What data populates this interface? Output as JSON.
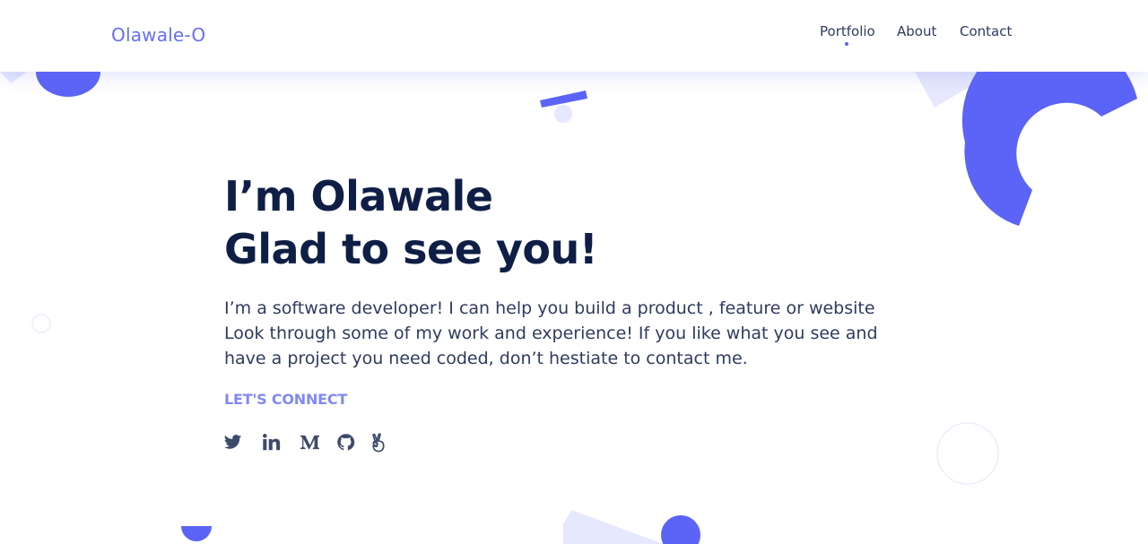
{
  "colors": {
    "accent": "#5b64f6",
    "accent_light": "#e6e8fd",
    "heading": "#0e1e45",
    "body_text": "#2e3b5e",
    "connect_label": "#8189f4"
  },
  "header": {
    "logo": "Olawale-O",
    "nav": [
      {
        "label": "Portfolio",
        "active": true
      },
      {
        "label": "About",
        "active": false
      },
      {
        "label": "Contact",
        "active": false
      }
    ]
  },
  "hero": {
    "headline_line1": "I’m Olawale",
    "headline_line2": "Glad to see you!",
    "bio": "I’m a software developer! I can help you build a product , feature or website Look through some of my work and experience! If you like what you see and have a project you need coded, don’t hestiate to contact me.",
    "connect_label": "LET'S CONNECT"
  },
  "social_links": [
    {
      "icon": "twitter-icon"
    },
    {
      "icon": "linkedin-icon"
    },
    {
      "icon": "medium-icon"
    },
    {
      "icon": "github-icon"
    },
    {
      "icon": "angellist-icon"
    }
  ]
}
